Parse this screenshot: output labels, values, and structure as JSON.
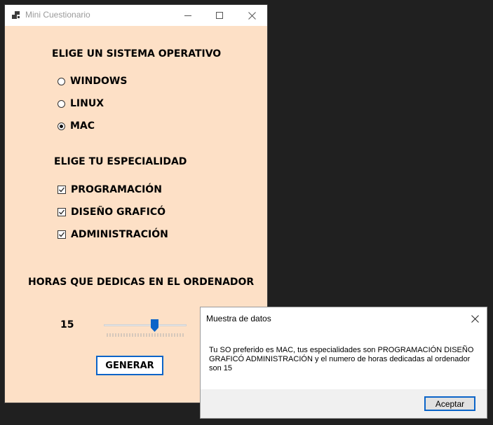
{
  "main_window": {
    "title": "Mini Cuestionario",
    "os_heading": "ELIGE UN SISTEMA OPERATIVO",
    "os_options": [
      {
        "label": "WINDOWS",
        "checked": false
      },
      {
        "label": "LINUX",
        "checked": false
      },
      {
        "label": "MAC",
        "checked": true
      }
    ],
    "specialty_heading": "ELIGE TU ESPECIALIDAD",
    "specialties": [
      {
        "label": "PROGRAMACIÓN",
        "checked": true
      },
      {
        "label": "DISEÑO GRAFICÓ",
        "checked": true
      },
      {
        "label": "ADMINISTRACIÓN",
        "checked": true
      }
    ],
    "hours_heading": "HORAS QUE DEDICAS EN EL ORDENADOR",
    "hours_value": "15",
    "slider_value_fraction": 0.6,
    "generate_label": "GENERAR"
  },
  "dialog": {
    "title": "Muestra de datos",
    "message": "Tu SO preferido es MAC, tus especialidades son PROGRAMACIÓN DISEÑO GRAFICÓ ADMINISTRACIÓN y el numero de horas dedicadas al ordenador son 15",
    "ok_label": "Aceptar"
  },
  "colors": {
    "form_background": "#fde0c6",
    "accent": "#0a64c8",
    "desktop": "#202020"
  }
}
